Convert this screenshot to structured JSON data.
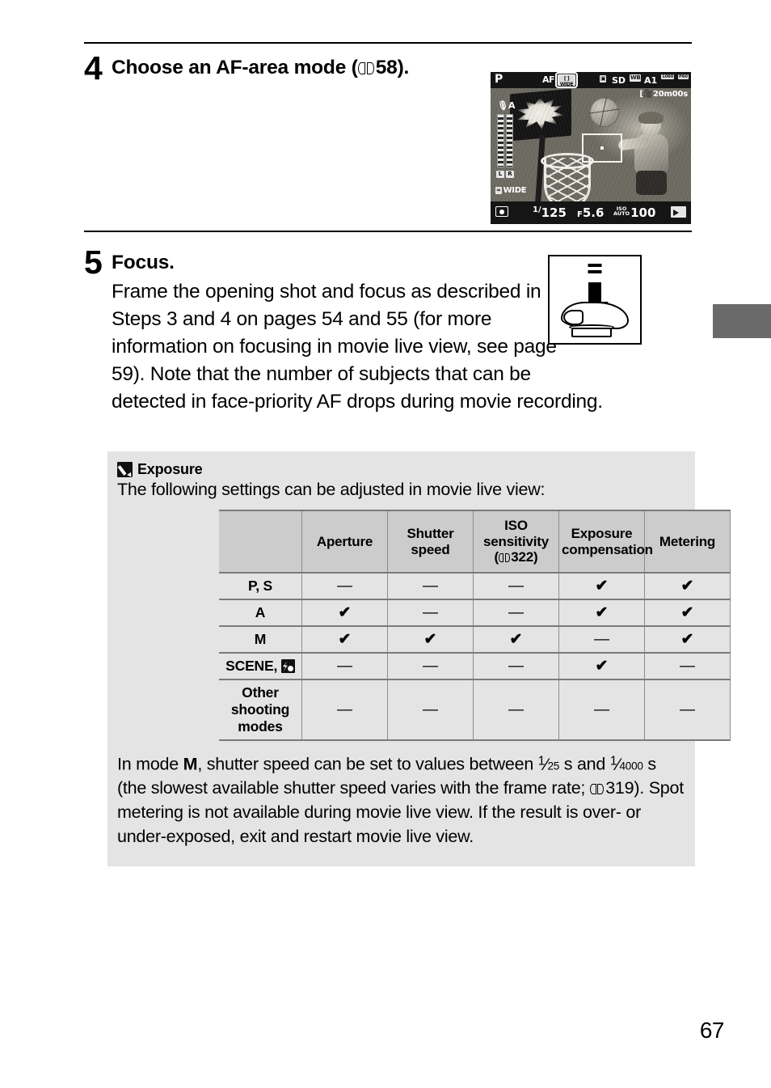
{
  "page": {
    "number": "67"
  },
  "steps": [
    {
      "number": "4",
      "title": "Choose an AF-area mode (",
      "title_ref": "58).",
      "illustration": "camera-lcd-movie-live-view"
    },
    {
      "number": "5",
      "title": "Focus.",
      "body": "Frame the opening shot and focus as described in Steps 3 and 4 on pages 54 and 55 (for more information on focusing in movie live view, see page 59).  Note that the number of subjects that can be detected in face-priority AF drops during movie recording.",
      "illustration": "press-shutter-release-button-halfway"
    }
  ],
  "lcd": {
    "mode": "P",
    "af_label": "AF",
    "af_mode_line1": "[ ]",
    "af_mode_line2": "WIDE",
    "card": "SD",
    "card_icon": "memory-card-icon",
    "wb_label": "WB",
    "wb_value": "A1",
    "frame_size": "1080",
    "frame_rate": "P60",
    "time_remaining": "20m00s",
    "mic_level": "A",
    "audio_left": "L",
    "audio_right": "R",
    "mic_sensitivity": "WIDE",
    "shutter_speed_num": "1/",
    "shutter_speed": "125",
    "aperture_prefix": "F",
    "aperture": "5.6",
    "iso_label": "ISO",
    "iso_auto_label": "AUTO",
    "iso_value": "100",
    "metering_icon": "center-weighted-metering-icon",
    "movie_icon": "movie-mode-icon"
  },
  "note": {
    "title": "Exposure",
    "icon": "pencil-note-icon",
    "lead": "The following settings can be adjusted in movie live view:",
    "table": {
      "headers": [
        "",
        "Aperture",
        "Shutter\nspeed",
        "ISO\nsensitivity\n(322)",
        "Exposure\ncompensation",
        "Metering"
      ],
      "header_iso_line1": "ISO",
      "header_iso_line2": "sensitivity",
      "header_iso_ref": "322)",
      "header_shutter_line1": "Shutter",
      "header_shutter_line2": "speed",
      "header_expcomp_line1": "Exposure",
      "header_expcomp_line2": "compensation",
      "rows": [
        {
          "mode": "P, S",
          "mode_icon": "",
          "values": [
            "—",
            "—",
            "—",
            "✔",
            "✔"
          ]
        },
        {
          "mode": "A",
          "mode_icon": "",
          "values": [
            "✔",
            "—",
            "—",
            "✔",
            "✔"
          ]
        },
        {
          "mode": "M",
          "mode_icon": "",
          "values": [
            "✔",
            "✔",
            "✔",
            "—",
            "✔"
          ]
        },
        {
          "mode": "SCENE,",
          "mode_icon": "special-effects-icon",
          "values": [
            "—",
            "—",
            "—",
            "✔",
            "—"
          ]
        },
        {
          "mode": "Other shooting modes",
          "mode_icon": "",
          "values": [
            "—",
            "—",
            "—",
            "—",
            "—"
          ]
        }
      ]
    },
    "tail_1": "In mode ",
    "tail_mode": "M",
    "tail_2": ", shutter speed can be set to values between ",
    "frac1_num": "1",
    "frac1_den": "25",
    "tail_3": " s and ",
    "frac2_num": "1",
    "frac2_den": "4000",
    "tail_4": " s (the slowest available shutter speed varies with the frame rate; ",
    "tail_ref": "319).",
    "tail_5": "  Spot metering is not available during movie live view. If the result is over- or under-exposed, exit and restart movie live view."
  }
}
